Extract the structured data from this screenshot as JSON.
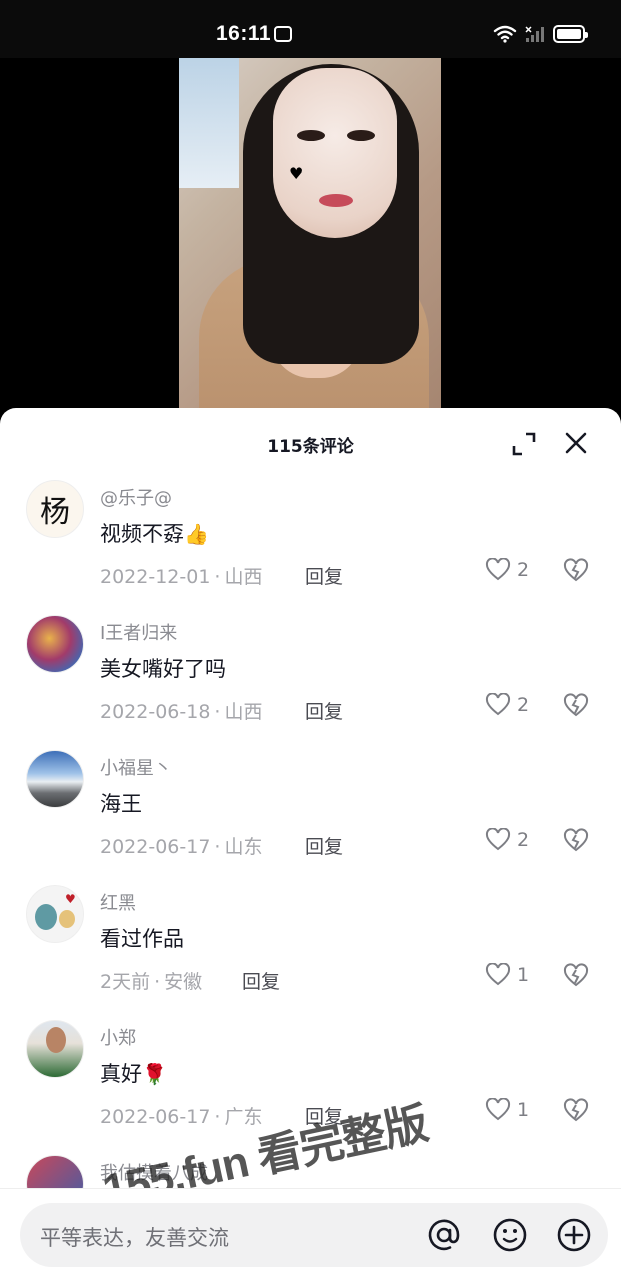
{
  "status_bar": {
    "time": "16:11"
  },
  "sheet": {
    "title": "115条评论"
  },
  "comments": [
    {
      "name": "@乐子@",
      "text": "视频不孬",
      "emoji": "👍",
      "date": "2022-12-01",
      "location": "山西",
      "reply": "回复",
      "likes": "2",
      "avatar_char": "杨"
    },
    {
      "name": "I王者归来",
      "text": "美女嘴好了吗",
      "emoji": "",
      "date": "2022-06-18",
      "location": "山西",
      "reply": "回复",
      "likes": "2"
    },
    {
      "name": "小福星丶",
      "text": "海王",
      "emoji": "",
      "date": "2022-06-17",
      "location": "山东",
      "reply": "回复",
      "likes": "2"
    },
    {
      "name": "红黑",
      "text": "看过作品",
      "emoji": "",
      "date": "2天前",
      "location": "安徽",
      "reply": "回复",
      "likes": "1"
    },
    {
      "name": "小郑",
      "text": "真好",
      "emoji": "🌹",
      "date": "2022-06-17",
      "location": "广东",
      "reply": "回复",
      "likes": "1"
    },
    {
      "name": "我估摸着八成"
    }
  ],
  "meta_separator": "·",
  "watermark": "155.fun 看完整版",
  "input": {
    "placeholder": "平等表达，友善交流"
  },
  "icons": [
    "wifi-icon",
    "signal-icon",
    "battery-icon",
    "expand-icon",
    "close-icon",
    "heart-icon",
    "dislike-icon",
    "mention-icon",
    "emoji-icon",
    "add-icon"
  ],
  "colors": {
    "sheet_bg": "#ffffff",
    "meta_text": "#a5a6ab",
    "primary_text": "#161823"
  }
}
